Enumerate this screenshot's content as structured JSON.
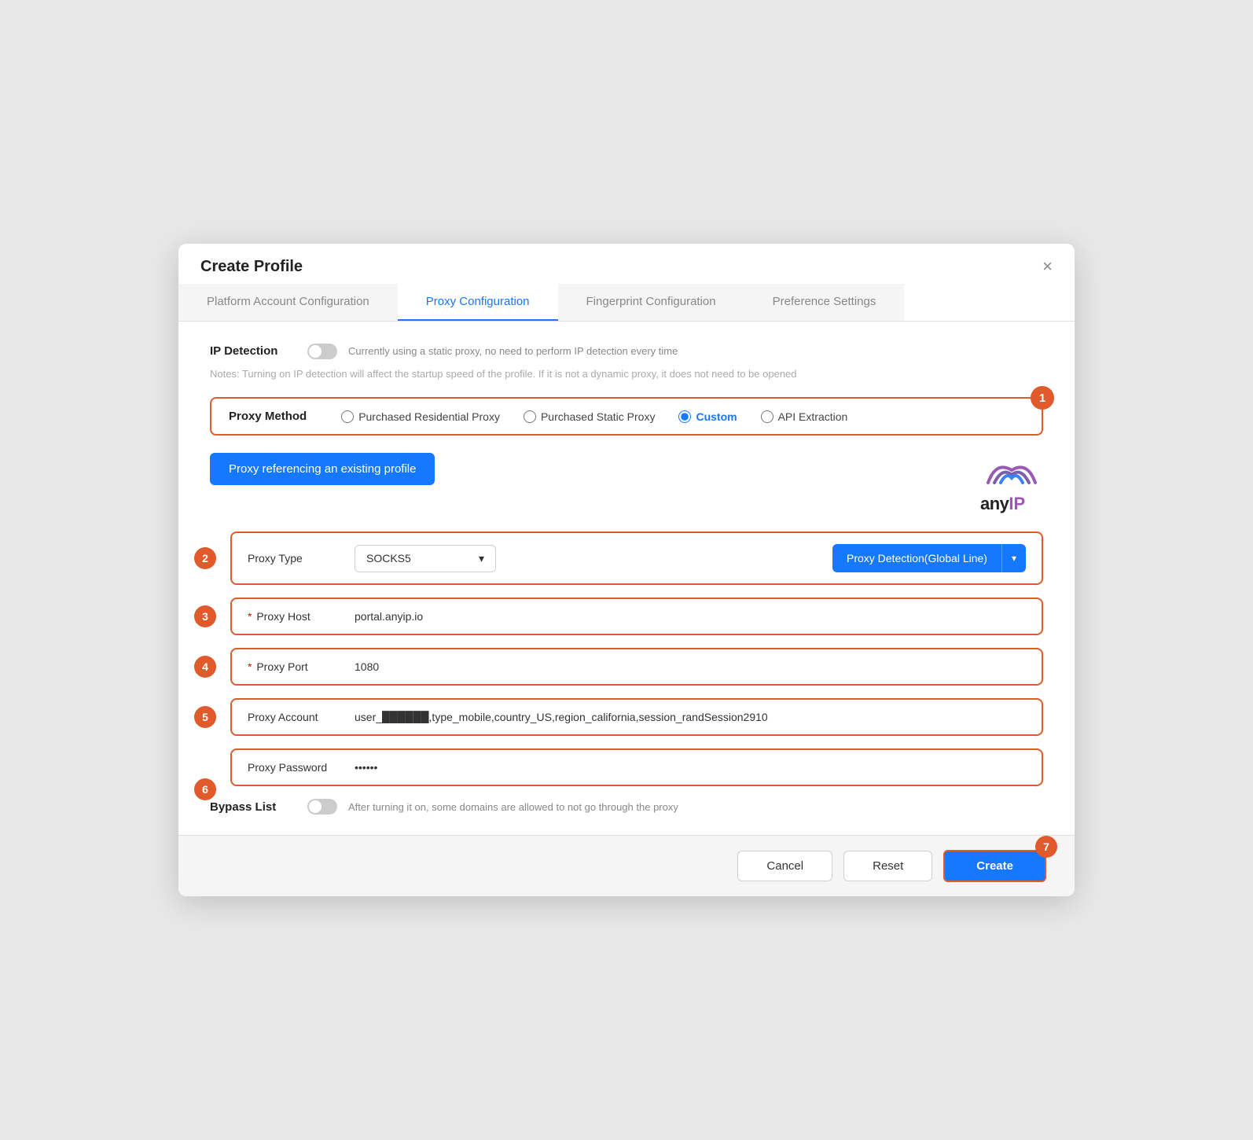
{
  "dialog": {
    "title": "Create Profile",
    "close_label": "×"
  },
  "tabs": [
    {
      "label": "Platform Account Configuration",
      "state": "inactive"
    },
    {
      "label": "Proxy Configuration",
      "state": "active"
    },
    {
      "label": "Fingerprint Configuration",
      "state": "inactive"
    },
    {
      "label": "Preference Settings",
      "state": "inactive"
    }
  ],
  "ip_detection": {
    "label": "IP Detection",
    "description": "Currently using a static proxy, no need to perform IP detection every time",
    "notes": "Notes: Turning on IP detection will affect the startup speed of the profile. If it is not a dynamic proxy, it does not need to be opened"
  },
  "proxy_method": {
    "label": "Proxy Method",
    "options": [
      {
        "label": "Purchased Residential Proxy",
        "selected": false
      },
      {
        "label": "Purchased Static Proxy",
        "selected": false
      },
      {
        "label": "Custom",
        "selected": true
      },
      {
        "label": "API Extraction",
        "selected": false
      }
    ]
  },
  "proxy_ref_btn": "Proxy referencing an existing profile",
  "proxy_type": {
    "label": "Proxy Type",
    "value": "SOCKS5"
  },
  "proxy_detection_btn": "Proxy Detection(Global Line)",
  "proxy_host": {
    "label": "Proxy Host",
    "value": "portal.anyip.io"
  },
  "proxy_port": {
    "label": "Proxy Port",
    "value": "1080"
  },
  "proxy_account": {
    "label": "Proxy Account",
    "value": "user_██████,type_mobile,country_US,region_california,session_randSession2910"
  },
  "proxy_password": {
    "label": "Proxy Password",
    "value": "••••••"
  },
  "bypass_list": {
    "label": "Bypass List",
    "description": "After turning it on, some domains are allowed to not go through the proxy"
  },
  "footer": {
    "cancel": "Cancel",
    "reset": "Reset",
    "create": "Create"
  },
  "step_badges": [
    "1",
    "2",
    "3",
    "4",
    "5",
    "6",
    "7"
  ],
  "anyip_logo_text": "anyIP",
  "colors": {
    "accent": "#1677ff",
    "badge": "#e05a2b",
    "active_tab": "#1677ff"
  }
}
